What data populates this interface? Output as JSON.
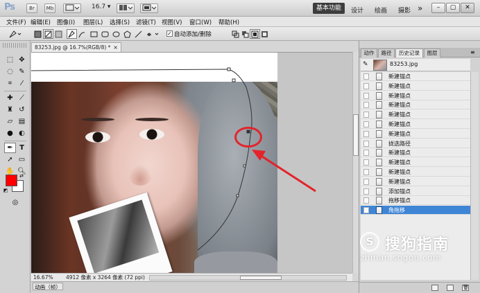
{
  "app": {
    "logo": "Ps",
    "bridge_label": "Br",
    "minibridge_label": "Mb",
    "zoom_level": "16.7",
    "workspace_active": "基本功能",
    "workspaces": [
      "设计",
      "绘画",
      "摄影"
    ],
    "more_label": "»"
  },
  "menu": {
    "items": [
      "文件(F)",
      "编辑(E)",
      "图像(I)",
      "图层(L)",
      "选择(S)",
      "滤镜(T)",
      "视图(V)",
      "窗口(W)",
      "帮助(H)"
    ]
  },
  "options": {
    "auto_add_delete_label": "自动添加/删除",
    "auto_add_delete_checked": true
  },
  "document": {
    "tab_label": "83253.jpg @ 16.7%(RGB/8) *",
    "close_label": "×"
  },
  "status": {
    "zoom": "16.67%",
    "doc_info": "4912 像素 x 3264 像素 (72 ppi)"
  },
  "animation_panel": {
    "tab_label": "动画（帧）"
  },
  "right_panel": {
    "tabs": [
      "动作",
      "路径",
      "历史记录",
      "图层"
    ],
    "active_tab": "历史记录",
    "snapshot_label": "83253.jpg",
    "history": [
      {
        "label": "新建锚点",
        "selected": false
      },
      {
        "label": "新建锚点",
        "selected": false
      },
      {
        "label": "新建锚点",
        "selected": false
      },
      {
        "label": "新建锚点",
        "selected": false
      },
      {
        "label": "新建锚点",
        "selected": false
      },
      {
        "label": "新建锚点",
        "selected": false
      },
      {
        "label": "新建锚点",
        "selected": false
      },
      {
        "label": "拢选路径",
        "selected": false
      },
      {
        "label": "新建锚点",
        "selected": false
      },
      {
        "label": "新建锚点",
        "selected": false
      },
      {
        "label": "新建锚点",
        "selected": false
      },
      {
        "label": "新建锚点",
        "selected": false
      },
      {
        "label": "添加锚点",
        "selected": false
      },
      {
        "label": "拖移锚点",
        "selected": false
      },
      {
        "label": "角拖移",
        "selected": true
      }
    ]
  },
  "watermark": {
    "logo_glyph": "S",
    "text": "搜狗指南",
    "url": "zhinan.sogou.com"
  },
  "colors": {
    "foreground": "#ff0000",
    "background": "#ffffff",
    "history_selected": "#3f85d6",
    "annotation_red": "#e3242b"
  }
}
